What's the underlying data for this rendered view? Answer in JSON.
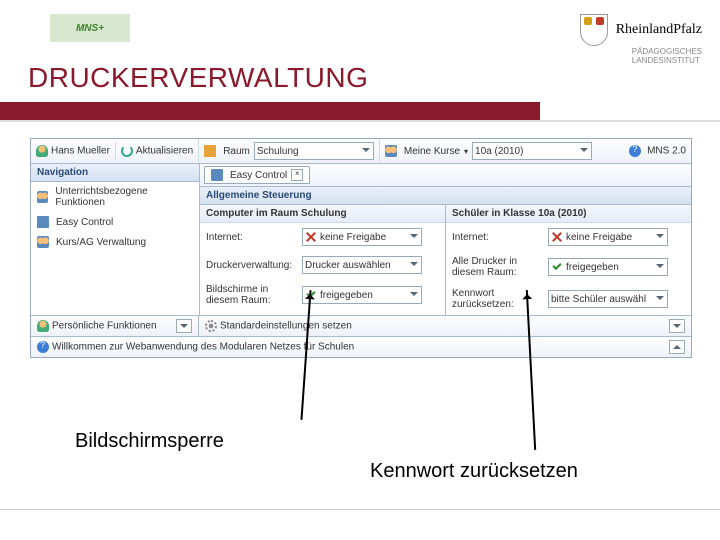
{
  "logo_mns": "MNS+",
  "rp_brand": "RheinlandPfalz",
  "rp_sub1": "PÄDAGOGISCHES",
  "rp_sub2": "LANDESINSTITUT",
  "title": "DRUCKERVERWALTUNG",
  "topbar": {
    "user": "Hans Mueller",
    "refresh": "Aktualisieren",
    "room_lbl": "Raum",
    "room_val": "Schulung",
    "courses_lbl": "Meine Kurse",
    "course_val": "10a (2010)",
    "brand": "MNS 2.0"
  },
  "nav": {
    "header": "Navigation",
    "items": [
      "Unterrichtsbezogene Funktionen",
      "Easy Control",
      "Kurs/AG Verwaltung"
    ]
  },
  "tab": {
    "label": "Easy Control"
  },
  "section_hd": "Allgemeine Steuerung",
  "left_col": {
    "header": "Computer im Raum Schulung",
    "internet_lbl": "Internet:",
    "internet_val": "keine Freigabe",
    "print_lbl": "Druckerverwaltung:",
    "print_val": "Drucker auswählen",
    "screen_lbl": "Bildschirme in diesem Raum:",
    "screen_val": "freigegeben"
  },
  "right_col": {
    "header": "Schüler in Klasse 10a (2010)",
    "internet_lbl": "Internet:",
    "internet_val": "keine Freigabe",
    "print_lbl": "Alle Drucker in diesem Raum:",
    "print_val": "freigegeben",
    "pw_lbl": "Kennwort zurücksetzen:",
    "pw_val": "bitte Schüler auswähl"
  },
  "side_foot": "Persönliche Funktionen",
  "main_foot": "Standardeinstellungen setzen",
  "statusbar": "Willkommen zur Webanwendung des Modularen Netzes für Schulen",
  "caption1": "Bildschirmsperre",
  "caption2": "Kennwort zurücksetzen"
}
